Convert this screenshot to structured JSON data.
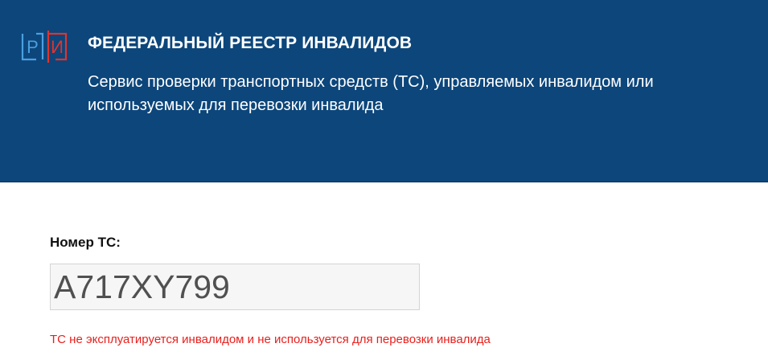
{
  "header": {
    "logo_letters": [
      "Р",
      "И"
    ],
    "title": "ФЕДЕРАЛЬНЫЙ РЕЕСТР ИНВАЛИДОВ",
    "subtitle": "Сервис проверки транспортных средств (ТС), управляемых инвалидом или используемых для перевозки инвалида"
  },
  "form": {
    "label": "Номер ТС:",
    "value": "A717XY799",
    "result_message": "ТС не эксплуатируется инвалидом и не используется для перевозки инвалида"
  },
  "colors": {
    "header_bg": "#0c467b",
    "logo_blue": "#4a9fe0",
    "logo_red": "#e2332b",
    "error_text": "#e8201d"
  },
  "icons": {
    "logo": "fri-logo-icon"
  }
}
